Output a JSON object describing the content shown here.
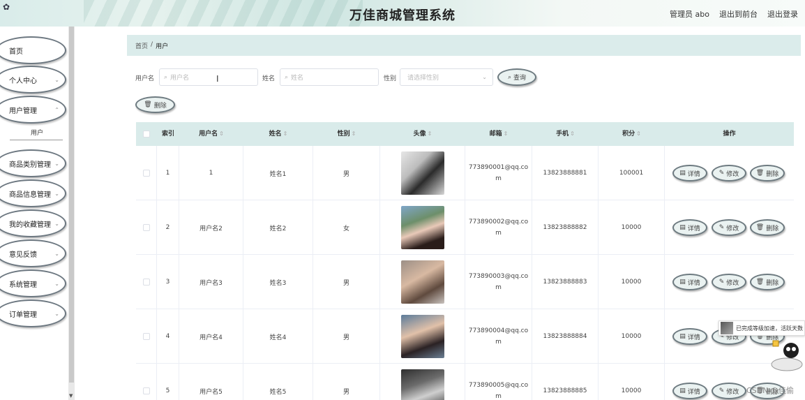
{
  "header": {
    "title": "万佳商城管理系统",
    "admin": "管理员 abo",
    "to_front": "退出到前台",
    "logout": "退出登录"
  },
  "sidebar": {
    "items": [
      {
        "label": "首页",
        "chevron": false
      },
      {
        "label": "个人中心",
        "chevron": true
      },
      {
        "label": "用户管理",
        "chevron": true
      },
      {
        "label": "商品类别管理",
        "chevron": true
      },
      {
        "label": "商品信息管理",
        "chevron": true
      },
      {
        "label": "我的收藏管理",
        "chevron": true
      },
      {
        "label": "意见反馈",
        "chevron": true
      },
      {
        "label": "系统管理",
        "chevron": true
      },
      {
        "label": "订单管理",
        "chevron": true
      }
    ],
    "sub_item": "用户"
  },
  "breadcrumb": {
    "home": "首页",
    "sep": "/",
    "current": "用户"
  },
  "search": {
    "username_label": "用户名",
    "username_placeholder": "用户名",
    "name_label": "姓名",
    "name_placeholder": "姓名",
    "gender_label": "性别",
    "gender_placeholder": "请选择性别",
    "query_button": "查询",
    "delete_button": "删除"
  },
  "table": {
    "headers": [
      "索引",
      "用户名",
      "姓名",
      "性别",
      "头像",
      "邮箱",
      "手机",
      "积分",
      "操作"
    ],
    "actions": {
      "detail": "详情",
      "edit": "修改",
      "delete": "删除"
    },
    "rows": [
      {
        "index": "1",
        "username": "1",
        "name": "姓名1",
        "gender": "男",
        "email": "773890001@qq.com",
        "phone": "13823888881",
        "points": "100001"
      },
      {
        "index": "2",
        "username": "用户名2",
        "name": "姓名2",
        "gender": "女",
        "email": "773890002@qq.com",
        "phone": "13823888882",
        "points": "10000"
      },
      {
        "index": "3",
        "username": "用户名3",
        "name": "姓名3",
        "gender": "男",
        "email": "773890003@qq.com",
        "phone": "13823888883",
        "points": "10000"
      },
      {
        "index": "4",
        "username": "用户名4",
        "name": "姓名4",
        "gender": "男",
        "email": "773890004@qq.com",
        "phone": "13823888884",
        "points": "10000"
      },
      {
        "index": "5",
        "username": "用户名5",
        "name": "姓名5",
        "gender": "男",
        "email": "773890005@qq.com",
        "phone": "13823888885",
        "points": "10000"
      }
    ]
  },
  "overlay": {
    "toast": "已完成等级加速，活跃天数",
    "watermark": "CSDN @佳偷"
  },
  "icons": {
    "search": "search-icon",
    "delete": "trash-icon",
    "detail": "document-icon",
    "edit": "pencil-icon",
    "chevron": "chevron-down-icon"
  },
  "colors": {
    "header_bg": "#dbeceb",
    "pill_border": "#6d7a80",
    "table_header_bg": "#d9ebea"
  }
}
